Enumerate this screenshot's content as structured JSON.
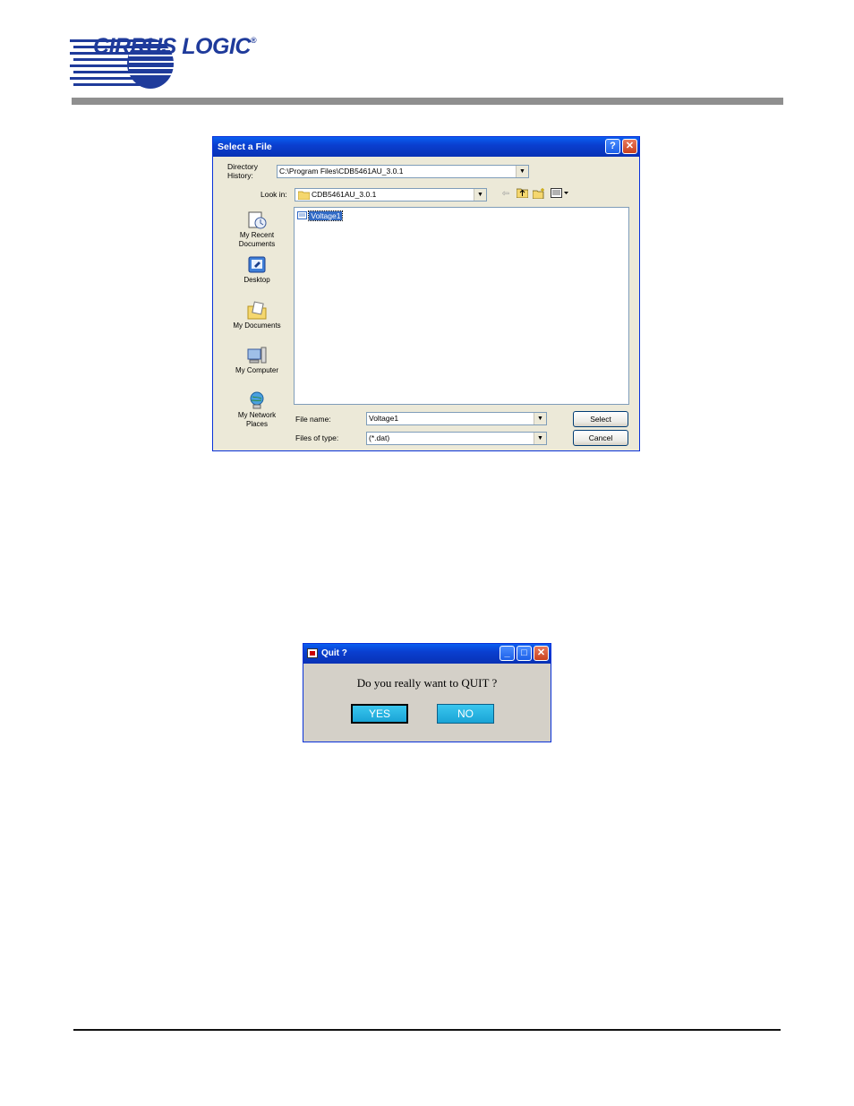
{
  "header": {
    "logo_text": "CIRRUS LOGIC",
    "logo_mark": "®"
  },
  "file_dialog": {
    "title": "Select a File",
    "help_button": "?",
    "close_button": "✕",
    "directory_history_label_1": "Directory",
    "directory_history_label_2": "History:",
    "directory_history_value": "C:\\Program Files\\CDB5461AU_3.0.1",
    "look_in_label": "Look in:",
    "look_in_value": "CDB5461AU_3.0.1",
    "places": [
      {
        "label_1": "My Recent",
        "label_2": "Documents"
      },
      {
        "label_1": "Desktop",
        "label_2": ""
      },
      {
        "label_1": "My Documents",
        "label_2": ""
      },
      {
        "label_1": "My Computer",
        "label_2": ""
      },
      {
        "label_1": "My Network",
        "label_2": "Places"
      }
    ],
    "files": [
      {
        "name": "Voltage1"
      }
    ],
    "file_name_label": "File name:",
    "file_name_value": "Voltage1",
    "files_of_type_label": "Files of type:",
    "files_of_type_value": "(*.dat)",
    "select_button": "Select",
    "cancel_button": "Cancel"
  },
  "quit_dialog": {
    "title": "Quit ?",
    "question": "Do you really want to QUIT ?",
    "yes_button": "YES",
    "no_button": "NO",
    "minimize": "_",
    "maximize": "□",
    "close": "✕"
  },
  "colors": {
    "xp_titlebar": "#0a3fd0",
    "dialog_face": "#ece9d8",
    "quit_face": "#d4d0c8",
    "quit_buttons": "#1aa4d6",
    "logo_blue": "#1f3b9b"
  }
}
